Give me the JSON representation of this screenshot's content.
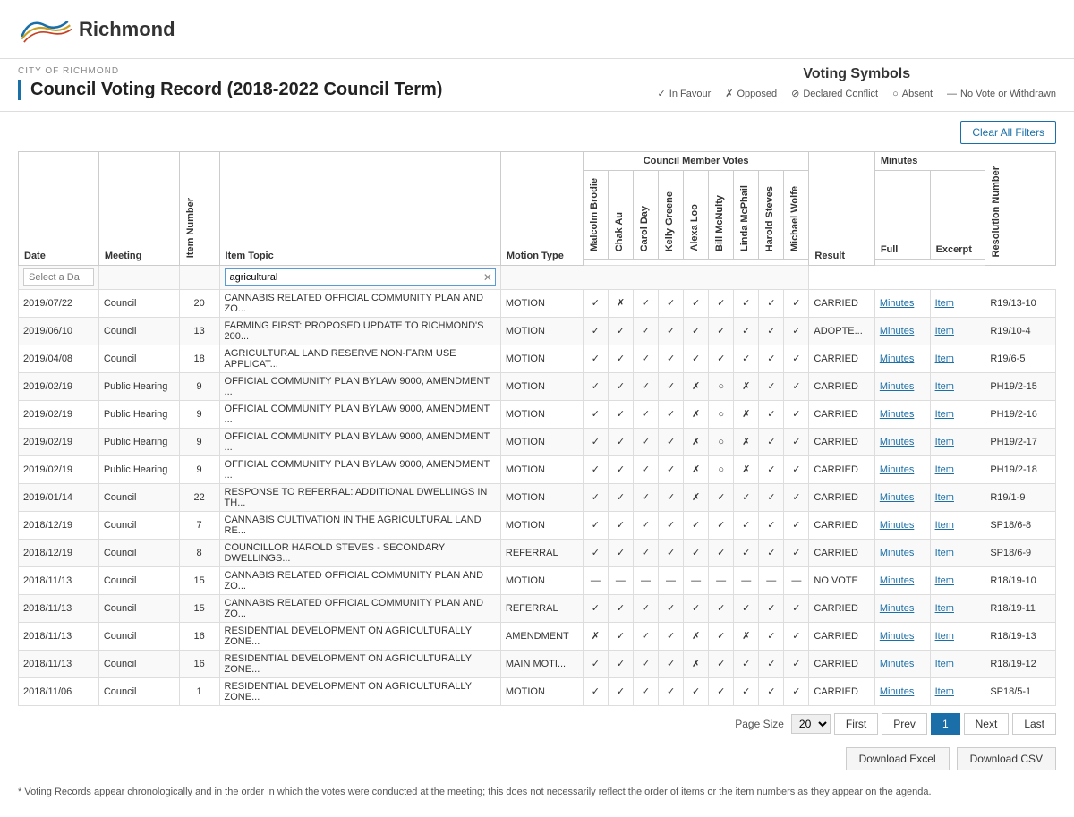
{
  "logo": {
    "city": "Richmond",
    "cityLabel": "CITY OF RICHMOND"
  },
  "pageTitle": "Council Voting Record (2018-2022 Council Term)",
  "votingSymbols": {
    "title": "Voting Symbols",
    "items": [
      {
        "symbol": "✓",
        "label": "In Favour"
      },
      {
        "symbol": "✗",
        "label": "Opposed"
      },
      {
        "symbol": "⊘",
        "label": "Declared Conflict"
      },
      {
        "symbol": "○",
        "label": "Absent"
      },
      {
        "symbol": "—",
        "label": "No Vote or Withdrawn"
      }
    ]
  },
  "filters": {
    "clearAllLabel": "Clear All Filters",
    "datePlaceholder": "Select a Da",
    "topicFilter": "agricultural"
  },
  "tableHeaders": {
    "date": "Date",
    "meeting": "Meeting",
    "itemNumber": "Item Number",
    "itemTopic": "Item Topic",
    "motionType": "Motion Type",
    "councilVotes": "Council Member Votes",
    "members": [
      "Malcolm Brodie",
      "Chak Au",
      "Carol Day",
      "Kelly Greene",
      "Alexa Loo",
      "Bill McNulty",
      "Linda McPhail",
      "Harold Steves",
      "Michael Wolfe"
    ],
    "result": "Result",
    "minutesFull": "Full",
    "minutesExcerpt": "Excerpt",
    "minutes": "Minutes",
    "resolutionNumber": "Resolution Number"
  },
  "rows": [
    {
      "date": "2019/07/22",
      "meeting": "Council",
      "itemNum": "20",
      "topic": "CANNABIS RELATED OFFICIAL COMMUNITY PLAN AND ZO...",
      "motionType": "MOTION",
      "votes": [
        "✓",
        "✗",
        "✓",
        "✓",
        "✓",
        "✓",
        "✓",
        "✓",
        "✓"
      ],
      "result": "CARRIED",
      "minutesLink": "Minutes",
      "itemLink": "Item",
      "resolution": "R19/13-10"
    },
    {
      "date": "2019/06/10",
      "meeting": "Council",
      "itemNum": "13",
      "topic": "FARMING FIRST: PROPOSED UPDATE TO RICHMOND'S 200...",
      "motionType": "MOTION",
      "votes": [
        "✓",
        "✓",
        "✓",
        "✓",
        "✓",
        "✓",
        "✓",
        "✓",
        "✓"
      ],
      "result": "ADOPTE...",
      "minutesLink": "Minutes",
      "itemLink": "Item",
      "resolution": "R19/10-4"
    },
    {
      "date": "2019/04/08",
      "meeting": "Council",
      "itemNum": "18",
      "topic": "AGRICULTURAL LAND RESERVE NON-FARM USE APPLICAT...",
      "motionType": "MOTION",
      "votes": [
        "✓",
        "✓",
        "✓",
        "✓",
        "✓",
        "✓",
        "✓",
        "✓",
        "✓"
      ],
      "result": "CARRIED",
      "minutesLink": "Minutes",
      "itemLink": "Item",
      "resolution": "R19/6-5"
    },
    {
      "date": "2019/02/19",
      "meeting": "Public Hearing",
      "itemNum": "9",
      "topic": "OFFICIAL COMMUNITY PLAN BYLAW 9000, AMENDMENT ...",
      "motionType": "MOTION",
      "votes": [
        "✓",
        "✓",
        "✓",
        "✓",
        "✗",
        "○",
        "✗",
        "✓",
        "✓"
      ],
      "result": "CARRIED",
      "minutesLink": "Minutes",
      "itemLink": "Item",
      "resolution": "PH19/2-15"
    },
    {
      "date": "2019/02/19",
      "meeting": "Public Hearing",
      "itemNum": "9",
      "topic": "OFFICIAL COMMUNITY PLAN BYLAW 9000, AMENDMENT ...",
      "motionType": "MOTION",
      "votes": [
        "✓",
        "✓",
        "✓",
        "✓",
        "✗",
        "○",
        "✗",
        "✓",
        "✓"
      ],
      "result": "CARRIED",
      "minutesLink": "Minutes",
      "itemLink": "Item",
      "resolution": "PH19/2-16"
    },
    {
      "date": "2019/02/19",
      "meeting": "Public Hearing",
      "itemNum": "9",
      "topic": "OFFICIAL COMMUNITY PLAN BYLAW 9000, AMENDMENT ...",
      "motionType": "MOTION",
      "votes": [
        "✓",
        "✓",
        "✓",
        "✓",
        "✗",
        "○",
        "✗",
        "✓",
        "✓"
      ],
      "result": "CARRIED",
      "minutesLink": "Minutes",
      "itemLink": "Item",
      "resolution": "PH19/2-17"
    },
    {
      "date": "2019/02/19",
      "meeting": "Public Hearing",
      "itemNum": "9",
      "topic": "OFFICIAL COMMUNITY PLAN BYLAW 9000, AMENDMENT ...",
      "motionType": "MOTION",
      "votes": [
        "✓",
        "✓",
        "✓",
        "✓",
        "✗",
        "○",
        "✗",
        "✓",
        "✓"
      ],
      "result": "CARRIED",
      "minutesLink": "Minutes",
      "itemLink": "Item",
      "resolution": "PH19/2-18"
    },
    {
      "date": "2019/01/14",
      "meeting": "Council",
      "itemNum": "22",
      "topic": "RESPONSE TO REFERRAL: ADDITIONAL DWELLINGS IN TH...",
      "motionType": "MOTION",
      "votes": [
        "✓",
        "✓",
        "✓",
        "✓",
        "✗",
        "✓",
        "✓",
        "✓",
        "✓"
      ],
      "result": "CARRIED",
      "minutesLink": "Minutes",
      "itemLink": "Item",
      "resolution": "R19/1-9"
    },
    {
      "date": "2018/12/19",
      "meeting": "Council",
      "itemNum": "7",
      "topic": "CANNABIS CULTIVATION IN THE AGRICULTURAL LAND RE...",
      "motionType": "MOTION",
      "votes": [
        "✓",
        "✓",
        "✓",
        "✓",
        "✓",
        "✓",
        "✓",
        "✓",
        "✓"
      ],
      "result": "CARRIED",
      "minutesLink": "Minutes",
      "itemLink": "Item",
      "resolution": "SP18/6-8"
    },
    {
      "date": "2018/12/19",
      "meeting": "Council",
      "itemNum": "8",
      "topic": "COUNCILLOR HAROLD STEVES - SECONDARY DWELLINGS...",
      "motionType": "REFERRAL",
      "votes": [
        "✓",
        "✓",
        "✓",
        "✓",
        "✓",
        "✓",
        "✓",
        "✓",
        "✓"
      ],
      "result": "CARRIED",
      "minutesLink": "Minutes",
      "itemLink": "Item",
      "resolution": "SP18/6-9"
    },
    {
      "date": "2018/11/13",
      "meeting": "Council",
      "itemNum": "15",
      "topic": "CANNABIS RELATED OFFICIAL COMMUNITY PLAN AND ZO...",
      "motionType": "MOTION",
      "votes": [
        "—",
        "—",
        "—",
        "—",
        "—",
        "—",
        "—",
        "—",
        "—"
      ],
      "result": "NO VOTE",
      "minutesLink": "Minutes",
      "itemLink": "Item",
      "resolution": "R18/19-10"
    },
    {
      "date": "2018/11/13",
      "meeting": "Council",
      "itemNum": "15",
      "topic": "CANNABIS RELATED OFFICIAL COMMUNITY PLAN AND ZO...",
      "motionType": "REFERRAL",
      "votes": [
        "✓",
        "✓",
        "✓",
        "✓",
        "✓",
        "✓",
        "✓",
        "✓",
        "✓"
      ],
      "result": "CARRIED",
      "minutesLink": "Minutes",
      "itemLink": "Item",
      "resolution": "R18/19-11"
    },
    {
      "date": "2018/11/13",
      "meeting": "Council",
      "itemNum": "16",
      "topic": "RESIDENTIAL DEVELOPMENT ON AGRICULTURALLY ZONE...",
      "motionType": "AMENDMENT",
      "votes": [
        "✗",
        "✓",
        "✓",
        "✓",
        "✗",
        "✓",
        "✗",
        "✓",
        "✓"
      ],
      "result": "CARRIED",
      "minutesLink": "Minutes",
      "itemLink": "Item",
      "resolution": "R18/19-13"
    },
    {
      "date": "2018/11/13",
      "meeting": "Council",
      "itemNum": "16",
      "topic": "RESIDENTIAL DEVELOPMENT ON AGRICULTURALLY ZONE...",
      "motionType": "MAIN MOTI...",
      "votes": [
        "✓",
        "✓",
        "✓",
        "✓",
        "✗",
        "✓",
        "✓",
        "✓",
        "✓"
      ],
      "result": "CARRIED",
      "minutesLink": "Minutes",
      "itemLink": "Item",
      "resolution": "R18/19-12"
    },
    {
      "date": "2018/11/06",
      "meeting": "Council",
      "itemNum": "1",
      "topic": "RESIDENTIAL DEVELOPMENT ON AGRICULTURALLY ZONE...",
      "motionType": "MOTION",
      "votes": [
        "✓",
        "✓",
        "✓",
        "✓",
        "✓",
        "✓",
        "✓",
        "✓",
        "✓"
      ],
      "result": "CARRIED",
      "minutesLink": "Minutes",
      "itemLink": "Item",
      "resolution": "SP18/5-1"
    }
  ],
  "pagination": {
    "pageSizeLabel": "Page Size",
    "pageSize": "20",
    "firstLabel": "First",
    "prevLabel": "Prev",
    "currentPage": "1",
    "nextLabel": "Next",
    "lastLabel": "Last"
  },
  "downloads": {
    "excelLabel": "Download Excel",
    "csvLabel": "Download CSV"
  },
  "footnote": "* Voting Records appear chronologically and in the order in which the votes were conducted at the meeting; this does not necessarily reflect the order of items or the item numbers as they appear on the agenda."
}
